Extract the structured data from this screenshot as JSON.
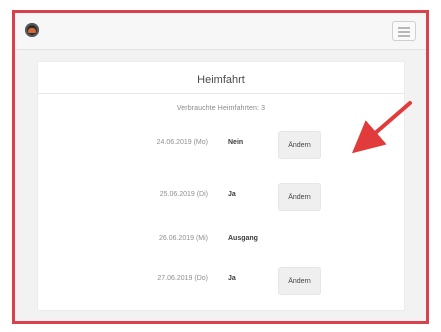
{
  "header": {
    "logo_icon": "club-logo-icon",
    "menu_icon": "hamburger-menu-icon"
  },
  "card": {
    "title": "Heimfahrt",
    "counter_text": "Verbrauchte Heimfahrten: 3"
  },
  "rows": [
    {
      "date": "24.06.2019 (Mo)",
      "answer": "Nein",
      "button_label": "Ändern"
    },
    {
      "date": "25.06.2019 (Di)",
      "answer": "Ja",
      "button_label": "Ändern"
    },
    {
      "date": "26.06.2019 (Mi)",
      "answer": "Ausgang",
      "button_label": ""
    },
    {
      "date": "27.06.2019 (Do)",
      "answer": "Ja",
      "button_label": "Ändern"
    }
  ],
  "annotation": {
    "arrow_color": "#e23b3b",
    "frame_color": "#d9424c"
  }
}
